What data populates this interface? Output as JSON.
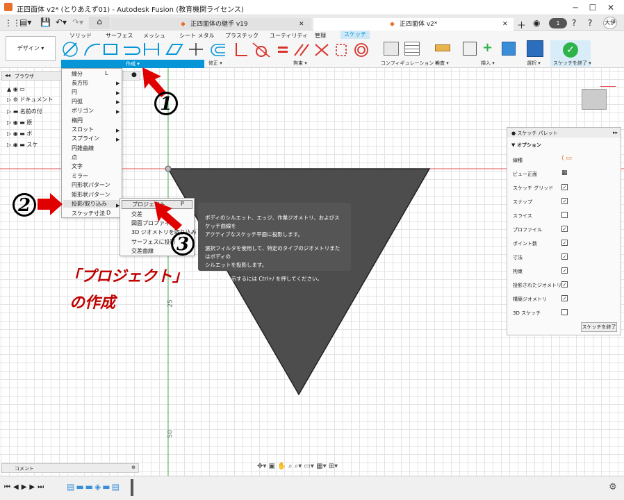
{
  "window": {
    "title": "正四面体 v2* (とりあえず01) - Autodesk Fusion (教育機関ライセンス)"
  },
  "tabs": [
    {
      "label": "正四面体の継手 v19"
    },
    {
      "label": "正四面体 v2*"
    }
  ],
  "user": {
    "initials": "大伊"
  },
  "notifications": {
    "count": "1"
  },
  "workspace": {
    "label": "デザイン ▾"
  },
  "ribbon_tabs": [
    "ソリッド",
    "サーフェス",
    "メッシュ",
    "シート メタル",
    "プラスチック",
    "ユーティリティ",
    "管理",
    "スケッチ"
  ],
  "groups": {
    "create": "作成 ▾",
    "modify": "修正 ▾",
    "constraints": "拘束 ▾",
    "configure": "コンフィギュレーション ▾",
    "inspect": "検査 ▾",
    "insert": "挿入 ▾",
    "select": "選択 ▾",
    "finish": "スケッチを終了 ▾"
  },
  "browser": {
    "title": "ブラウザ",
    "items": [
      "ドキュメント",
      "名前の付",
      "原",
      "ボ",
      "スケ"
    ]
  },
  "create_menu": {
    "items": [
      {
        "label": "線分",
        "key": "L"
      },
      {
        "label": "長方形"
      },
      {
        "label": "円"
      },
      {
        "label": "円弧"
      },
      {
        "label": "ポリゴン"
      },
      {
        "label": "楕円"
      },
      {
        "label": "スロット"
      },
      {
        "label": "スプライン"
      },
      {
        "label": "円錐曲線"
      },
      {
        "label": "点"
      },
      {
        "label": "文字"
      },
      {
        "label": "ミラー"
      },
      {
        "label": "円形状パターン"
      },
      {
        "label": "矩形状パターン"
      },
      {
        "label": "投影/取り込み"
      },
      {
        "label": "スケッチ寸法",
        "key": "D"
      }
    ]
  },
  "project_submenu": {
    "items": [
      {
        "label": "プロジェクト",
        "key": "P"
      },
      {
        "label": "交差"
      },
      {
        "label": "図面プロファイル"
      },
      {
        "label": "3D ジオメトリを取り込み"
      },
      {
        "label": "サーフェスに投影"
      },
      {
        "label": "交差曲線"
      }
    ]
  },
  "tooltip": {
    "line1": "ボディのシルエット、エッジ、作業ジオメトリ、およびスケッチ曲線を",
    "line2": "アクティブなスケッチ平面に投影します。",
    "line3": "選択フィルタを使用して、特定のタイプのジオメトリまたはボディの",
    "line4": "シルエットを投影します。",
    "line5": "ヘルプを表示するには Ctrl+/ を押してください。"
  },
  "axis_labels": {
    "y25": "25",
    "y50": "50"
  },
  "palette": {
    "title": "スケッチ パレット",
    "section": "オプション",
    "rows": [
      {
        "label": "線種"
      },
      {
        "label": "ビュー正面"
      },
      {
        "label": "スケッチ グリッド",
        "checked": true
      },
      {
        "label": "スナップ",
        "checked": true
      },
      {
        "label": "スライス",
        "checked": false
      },
      {
        "label": "プロファイル",
        "checked": true
      },
      {
        "label": "ポイント数",
        "checked": true
      },
      {
        "label": "寸法",
        "checked": true
      },
      {
        "label": "拘束",
        "checked": true
      },
      {
        "label": "投影されたジオメトリ",
        "checked": true
      },
      {
        "label": "構築ジオメトリ",
        "checked": true
      },
      {
        "label": "3D スケッチ",
        "checked": false
      }
    ],
    "finish_button": "スケッチを終了"
  },
  "comment": {
    "label": "コメント"
  },
  "annotations": {
    "step1": "1",
    "step2": "2",
    "step3": "3",
    "caption_line1": "「プロジェクト」",
    "caption_line2": "の作成"
  },
  "colors": {
    "accent": "#0696d7",
    "arrow": "#e00000",
    "triangle": "#4d4d4d",
    "finish": "#2eb34a"
  }
}
